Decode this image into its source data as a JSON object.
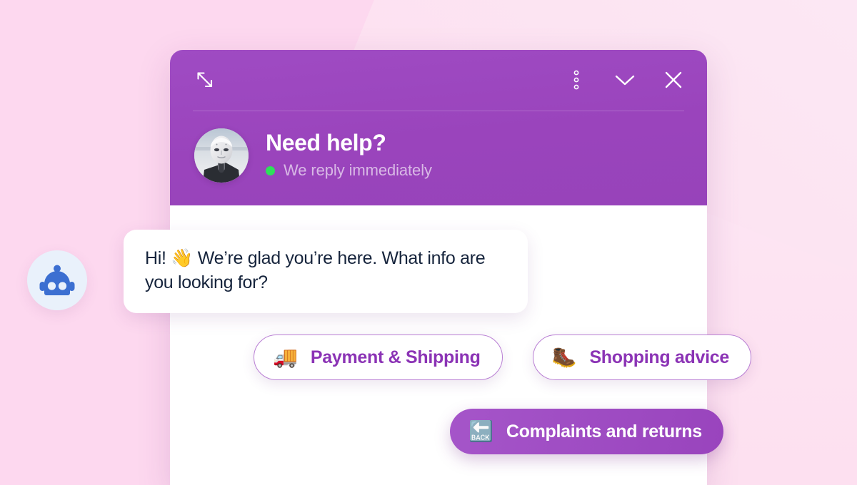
{
  "theme": {
    "page_background": "#fdd8ef",
    "brand_purple": "#9a44bc",
    "chip_border": "#b97fd4",
    "chip_text": "#8b33b5",
    "status_green": "#2ee05a",
    "bubble_text": "#16243c",
    "launcher_bg": "#e9f1fb",
    "launcher_icon": "#3c6fd1"
  },
  "launcher": {
    "icon": "robot-head-icon"
  },
  "widget": {
    "header": {
      "controls_left": [
        {
          "name": "expand-icon",
          "label": "Expand"
        }
      ],
      "controls_right": [
        {
          "name": "more-options-icon",
          "label": "More options"
        },
        {
          "name": "chevron-down-icon",
          "label": "Minimize"
        },
        {
          "name": "close-icon",
          "label": "Close"
        }
      ],
      "avatar_icon": "agent-avatar",
      "title": "Need help?",
      "status": "We reply immediately",
      "status_indicator": "online"
    },
    "messages": [
      {
        "sender": "bot",
        "text": "Hi! 👋 We’re glad you’re here. What info are you looking for?"
      }
    ],
    "quick_replies": [
      {
        "emoji": "🚚",
        "icon_name": "delivery-truck-icon",
        "label": "Payment & Shipping",
        "style": "outline"
      },
      {
        "emoji": "🥾",
        "icon_name": "hiking-boot-icon",
        "label": "Shopping advice",
        "style": "outline"
      },
      {
        "emoji": "🔙",
        "icon_name": "back-arrow-icon",
        "label": "Complaints and returns",
        "style": "filled"
      }
    ]
  }
}
